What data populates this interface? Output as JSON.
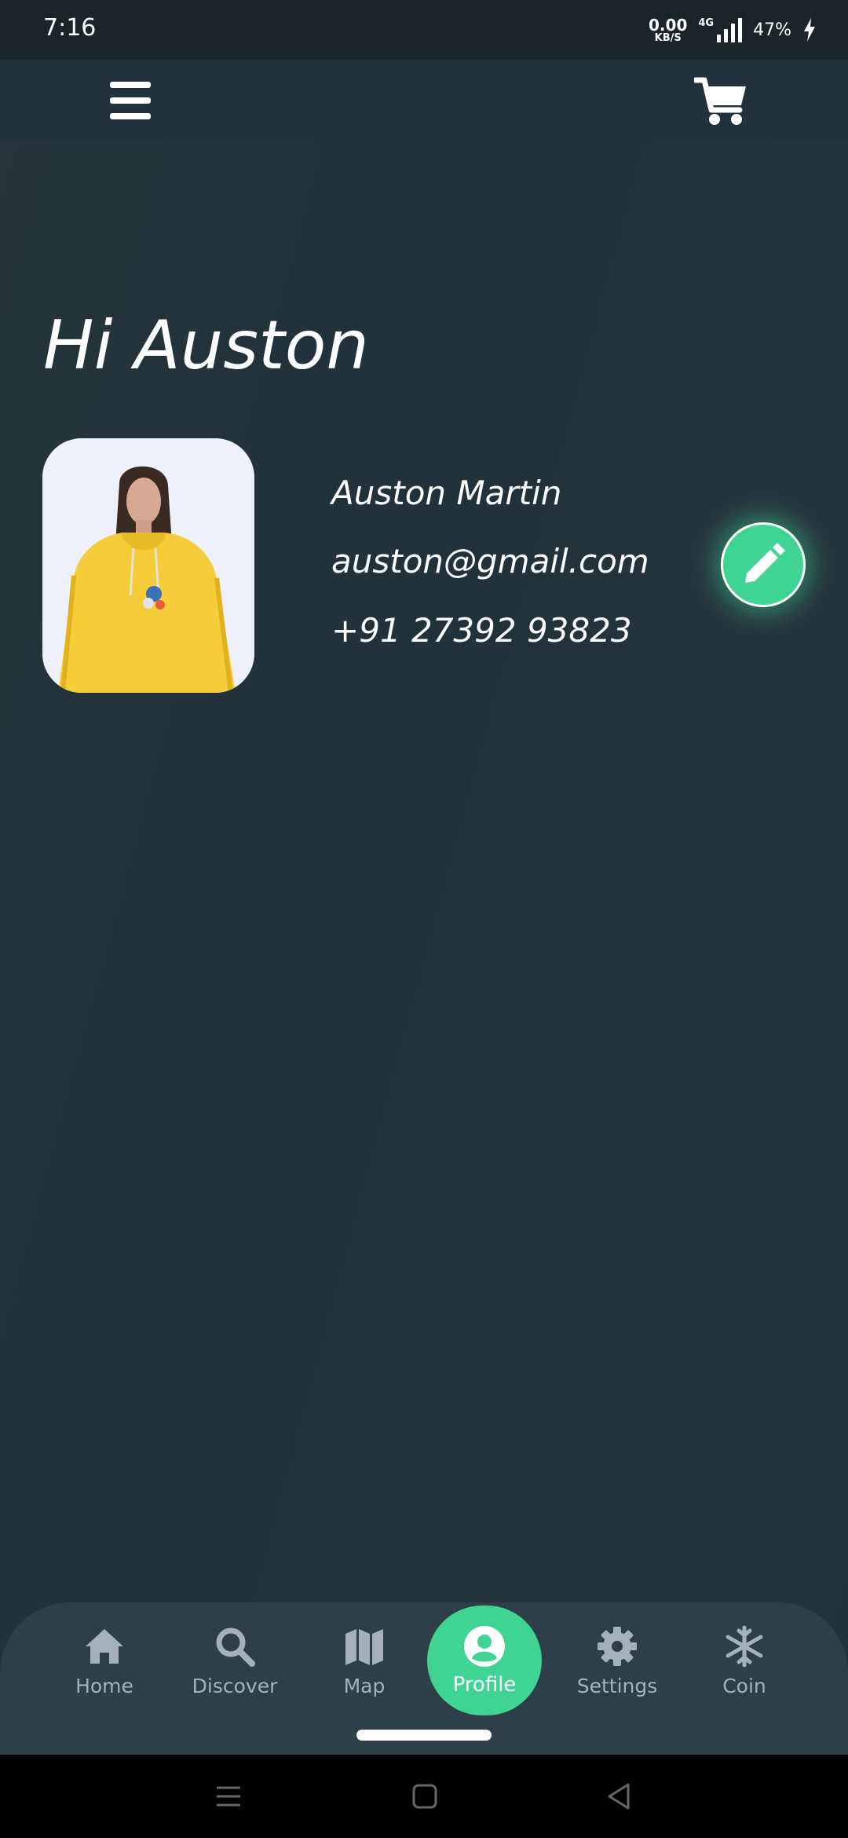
{
  "status_bar": {
    "time": "7:16",
    "net_speed_value": "0.00",
    "net_speed_unit": "KB/S",
    "network_type": "4G",
    "battery": "47%"
  },
  "header": {
    "menu_icon": "hamburger-menu-icon",
    "cart_icon": "shopping-cart-icon"
  },
  "profile": {
    "greeting": "Hi Auston",
    "name": "Auston Martin",
    "email": "auston@gmail.com",
    "phone": "+91 27392 93823",
    "avatar_icon": "profile-photo-yellow-hoodie",
    "edit_icon": "pencil-icon"
  },
  "bottom_nav": {
    "items": [
      {
        "label": "Home",
        "icon": "home-icon"
      },
      {
        "label": "Discover",
        "icon": "search-icon"
      },
      {
        "label": "Map",
        "icon": "map-icon"
      },
      {
        "label": "Profile",
        "icon": "user-circle-icon",
        "active": true
      },
      {
        "label": "Settings",
        "icon": "gear-icon"
      },
      {
        "label": "Coin",
        "icon": "snowflake-icon"
      }
    ]
  },
  "colors": {
    "accent": "#3fd494",
    "background": "#23313a",
    "nav_background": "#2f3f48",
    "nav_inactive": "#a6b0ba"
  }
}
